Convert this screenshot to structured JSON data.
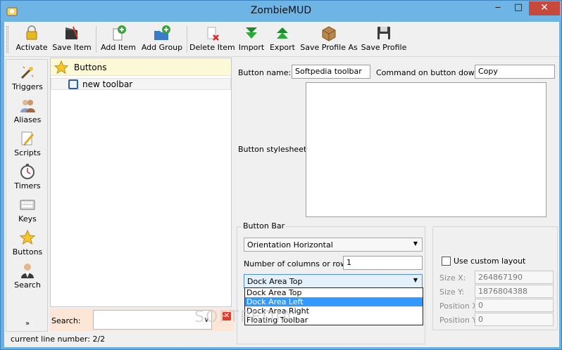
{
  "window": {
    "title": "ZombieMUD"
  },
  "toolbar": {
    "buttons": [
      {
        "label": "Activate",
        "icon": "lock-icon"
      },
      {
        "label": "Save Item",
        "icon": "clapperboard-save-icon"
      },
      {
        "label": "Add Item",
        "icon": "add-item-icon"
      },
      {
        "label": "Add Group",
        "icon": "add-group-icon"
      },
      {
        "label": "Delete Item",
        "icon": "delete-item-icon"
      },
      {
        "label": "Import",
        "icon": "import-arrow-icon"
      },
      {
        "label": "Export",
        "icon": "export-arrow-icon"
      },
      {
        "label": "Save Profile As",
        "icon": "package-icon"
      },
      {
        "label": "Save Profile",
        "icon": "floppy-disk-icon"
      }
    ]
  },
  "sidebar": {
    "items": [
      {
        "label": "Triggers",
        "icon": "wand-icon"
      },
      {
        "label": "Aliases",
        "icon": "people-icon"
      },
      {
        "label": "Scripts",
        "icon": "pencil-icon"
      },
      {
        "label": "Timers",
        "icon": "stopwatch-icon"
      },
      {
        "label": "Keys",
        "icon": "keyboard-icon"
      },
      {
        "label": "Buttons",
        "icon": "star-icon"
      },
      {
        "label": "Search",
        "icon": "search-person-icon"
      }
    ],
    "more": "»"
  },
  "tree": {
    "root": "Buttons",
    "child": "new toolbar"
  },
  "search": {
    "label": "Search:",
    "value": ""
  },
  "status": {
    "text": "current line number: 2/2"
  },
  "form": {
    "button_name_label": "Button name:",
    "button_name_value": "Softpedia toolbar",
    "command_down_label": "Command on button down:",
    "command_down_value": "Copy",
    "stylesheet_label": "Button stylesheet:",
    "stylesheet_value": "",
    "button_bar": {
      "title": "Button Bar",
      "orientation": "Orientation Horizontal",
      "columns_label": "Number of columns or rows:",
      "columns_value": "1",
      "dock_area": "Dock Area Top",
      "dock_options": [
        "Dock Area Top",
        "Dock Area Left",
        "Dock Area Right",
        "Floating Toolbar"
      ],
      "dock_highlighted": "Dock Area Left"
    },
    "custom_layout": {
      "checkbox_label": "Use custom layout",
      "checked": false,
      "size_x_label": "Size X:",
      "size_x_value": "264867190",
      "size_y_label": "Size Y:",
      "size_y_value": "1876804388",
      "pos_x_label": "Position X:",
      "pos_x_value": "0",
      "pos_y_label": "Position Y:",
      "pos_y_value": "0"
    }
  },
  "watermark": "SOFTPEDIA",
  "colors": {
    "titlebar": "#6eb5e6",
    "close_button": "#c7493c",
    "selection": "#3399ff",
    "tree_root_bg": "#fcf9d7"
  }
}
